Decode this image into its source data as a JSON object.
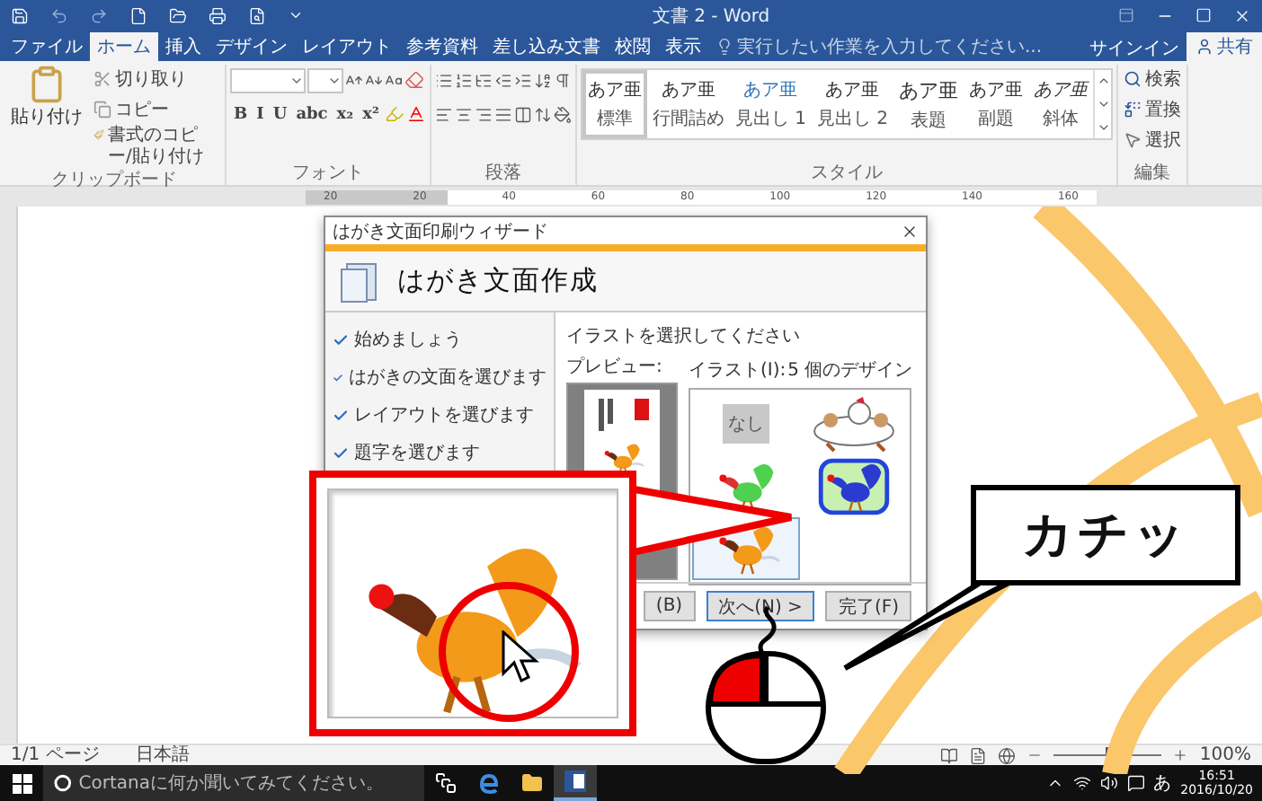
{
  "window": {
    "title": "文書 2 - Word",
    "search_placeholder": "実行したい作業を入力してください...",
    "signin": "サインイン",
    "share": "共有"
  },
  "tabs": [
    {
      "label": "ファイル",
      "selected": false
    },
    {
      "label": "ホーム",
      "selected": true
    },
    {
      "label": "挿入",
      "selected": false
    },
    {
      "label": "デザイン",
      "selected": false
    },
    {
      "label": "レイアウト",
      "selected": false
    },
    {
      "label": "参考資料",
      "selected": false
    },
    {
      "label": "差し込み文書",
      "selected": false
    },
    {
      "label": "校閲",
      "selected": false
    },
    {
      "label": "表示",
      "selected": false
    }
  ],
  "ribbon": {
    "clipboard": {
      "label": "クリップボード",
      "paste": "貼り付け",
      "cut": "切り取り",
      "copy": "コピー",
      "format_painter": "書式のコピー/貼り付け"
    },
    "font": {
      "label": "フォント",
      "format_buttons": [
        "B",
        "I",
        "U",
        "abc",
        "x₂",
        "x²"
      ]
    },
    "paragraph": {
      "label": "段落"
    },
    "styles": {
      "label": "スタイル",
      "items": [
        {
          "sample": "あア亜",
          "name": "標準",
          "selected": true
        },
        {
          "sample": "あア亜",
          "name": "行間詰め",
          "selected": false
        },
        {
          "sample": "あア亜",
          "name": "見出し 1",
          "selected": false
        },
        {
          "sample": "あア亜",
          "name": "見出し 2",
          "selected": false
        },
        {
          "sample": "あア亜",
          "name": "表題",
          "selected": false
        },
        {
          "sample": "あア亜",
          "name": "副題",
          "selected": false
        },
        {
          "sample": "あア亜",
          "name": "斜体",
          "selected": false
        }
      ]
    },
    "editing": {
      "label": "編集",
      "find": "検索",
      "replace": "置換",
      "select": "選択"
    }
  },
  "ruler": {
    "labels": [
      "20",
      "20",
      "40",
      "60",
      "80",
      "100",
      "120",
      "140",
      "160"
    ]
  },
  "dialog": {
    "title": "はがき文面印刷ウィザード",
    "heading": "はがき文面作成",
    "steps": [
      {
        "label": "始めましょう",
        "checked": true
      },
      {
        "label": "はがきの文面を選びます",
        "checked": true
      },
      {
        "label": "レイアウトを選びます",
        "checked": true
      },
      {
        "label": "題字を選びます",
        "checked": true
      }
    ],
    "instruction": "イラストを選択してください",
    "preview_label": "プレビュー:",
    "illust_label": "イラスト(I):",
    "count": "5 個のデザイン",
    "illustrations": [
      {
        "kind": "none",
        "label": "なし",
        "selected": false
      },
      {
        "kind": "bath",
        "selected": false
      },
      {
        "kind": "green",
        "selected": false
      },
      {
        "kind": "framed",
        "selected": false
      },
      {
        "kind": "brown",
        "selected": true
      }
    ],
    "buttons": [
      {
        "label": "(B)",
        "default": false
      },
      {
        "label": "次へ(N) >",
        "default": true
      },
      {
        "label": "完了(F)",
        "default": false
      }
    ]
  },
  "overlay": {
    "sound": "カチッ"
  },
  "status_bar": {
    "page": "1/1 ページ",
    "language": "日本語",
    "zoom": "100%",
    "zoom_slider": {
      "level": 0.5
    }
  },
  "taskbar": {
    "search_placeholder": "Cortanaに何か聞いてみてください。",
    "ime": "あ",
    "time": "16:51",
    "date": "2016/10/20"
  }
}
